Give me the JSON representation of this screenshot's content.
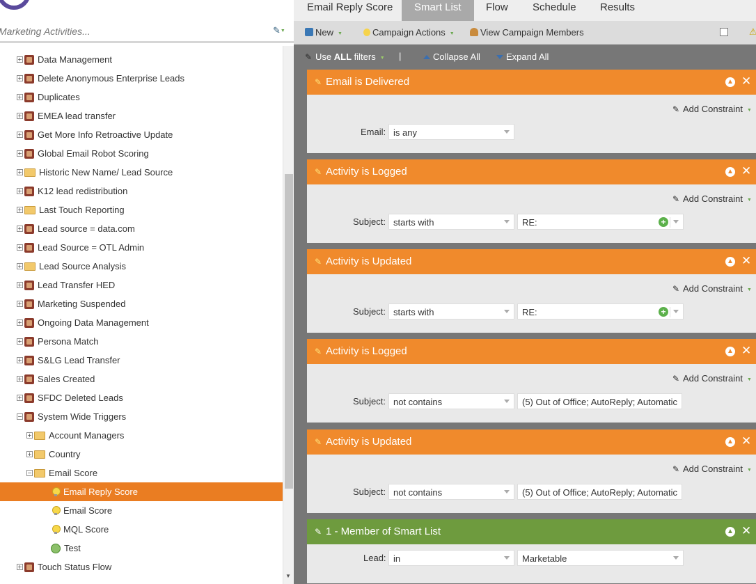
{
  "left_pane": {
    "search": {
      "placeholder": "Marketing Activities..."
    },
    "tree": [
      {
        "label": "Data Management",
        "icon": "campaign-folder-icon",
        "indent": 0,
        "expander": "+"
      },
      {
        "label": "Delete Anonymous Enterprise Leads",
        "icon": "campaign-folder-icon",
        "indent": 0,
        "expander": "+"
      },
      {
        "label": "Duplicates",
        "icon": "campaign-folder-icon",
        "indent": 0,
        "expander": "+"
      },
      {
        "label": "EMEA lead transfer",
        "icon": "campaign-folder-icon",
        "indent": 0,
        "expander": "+"
      },
      {
        "label": "Get More Info Retroactive Update",
        "icon": "campaign-folder-icon",
        "indent": 0,
        "expander": "+"
      },
      {
        "label": "Global Email Robot Scoring",
        "icon": "campaign-folder-icon",
        "indent": 0,
        "expander": "+"
      },
      {
        "label": "Historic New Name/ Lead Source",
        "icon": "folder-icon",
        "indent": 0,
        "expander": "+"
      },
      {
        "label": "K12 lead redistribution",
        "icon": "campaign-folder-icon",
        "indent": 0,
        "expander": "+"
      },
      {
        "label": "Last Touch Reporting",
        "icon": "folder-icon",
        "indent": 0,
        "expander": "+"
      },
      {
        "label": "Lead source = data.com",
        "icon": "campaign-folder-icon",
        "indent": 0,
        "expander": "+"
      },
      {
        "label": "Lead Source = OTL Admin",
        "icon": "campaign-folder-icon",
        "indent": 0,
        "expander": "+"
      },
      {
        "label": "Lead Source Analysis",
        "icon": "folder-icon",
        "indent": 0,
        "expander": "+"
      },
      {
        "label": "Lead Transfer HED",
        "icon": "campaign-folder-icon",
        "indent": 0,
        "expander": "+"
      },
      {
        "label": "Marketing Suspended",
        "icon": "campaign-folder-icon",
        "indent": 0,
        "expander": "+"
      },
      {
        "label": "Ongoing Data Management",
        "icon": "campaign-folder-icon",
        "indent": 0,
        "expander": "+"
      },
      {
        "label": "Persona Match",
        "icon": "campaign-folder-icon",
        "indent": 0,
        "expander": "+"
      },
      {
        "label": "S&LG Lead Transfer",
        "icon": "campaign-folder-icon",
        "indent": 0,
        "expander": "+"
      },
      {
        "label": "Sales Created",
        "icon": "campaign-folder-icon",
        "indent": 0,
        "expander": "+"
      },
      {
        "label": "SFDC Deleted Leads",
        "icon": "campaign-folder-icon",
        "indent": 0,
        "expander": "+"
      },
      {
        "label": "System Wide Triggers",
        "icon": "campaign-folder-icon",
        "indent": 0,
        "expander": "−"
      },
      {
        "label": "Account Managers",
        "icon": "folder-icon",
        "indent": 1,
        "expander": "+"
      },
      {
        "label": "Country",
        "icon": "folder-icon",
        "indent": 1,
        "expander": "+"
      },
      {
        "label": "Email Score",
        "icon": "folder-icon",
        "indent": 1,
        "expander": "−"
      },
      {
        "label": "Email Reply Score",
        "icon": "smart-campaign-icon",
        "indent": 2,
        "expander": "",
        "selected": true
      },
      {
        "label": "Email Score",
        "icon": "smart-campaign-icon",
        "indent": 2,
        "expander": ""
      },
      {
        "label": "MQL Score",
        "icon": "smart-campaign-icon",
        "indent": 2,
        "expander": ""
      },
      {
        "label": "Test",
        "icon": "test-campaign-icon",
        "indent": 2,
        "expander": ""
      },
      {
        "label": "Touch Status Flow",
        "icon": "campaign-folder-icon",
        "indent": 0,
        "expander": "+"
      }
    ]
  },
  "tabs": [
    {
      "label": "Email Reply Score",
      "active": false
    },
    {
      "label": "Smart List",
      "active": true
    },
    {
      "label": "Flow",
      "active": false
    },
    {
      "label": "Schedule",
      "active": false
    },
    {
      "label": "Results",
      "active": false
    }
  ],
  "toolbar": {
    "new_label": "New",
    "campaign_actions_label": "Campaign Actions",
    "view_members_label": "View Campaign Members"
  },
  "filterbar": {
    "use_prefix": "Use",
    "use_bold": "ALL",
    "use_suffix": "filters",
    "separator": "|",
    "collapse_label": "Collapse All",
    "expand_label": "Expand All"
  },
  "filters": [
    {
      "title": "Email is Delivered",
      "color": "#f08a2c",
      "add_constraint": "Add Constraint",
      "field_label": "Email:",
      "operator": "is any"
    },
    {
      "title": "Activity is Logged",
      "color": "#f08a2c",
      "add_constraint": "Add Constraint",
      "field_label": "Subject:",
      "operator": "starts with",
      "value": "RE:"
    },
    {
      "title": "Activity is Updated",
      "color": "#f08a2c",
      "add_constraint": "Add Constraint",
      "field_label": "Subject:",
      "operator": "starts with",
      "value": "RE:"
    },
    {
      "title": "Activity is Logged",
      "color": "#f08a2c",
      "add_constraint": "Add Constraint",
      "field_label": "Subject:",
      "operator": "not contains",
      "value": "(5) Out of Office; AutoReply; Automatic"
    },
    {
      "title": "Activity is Updated",
      "color": "#f08a2c",
      "add_constraint": "Add Constraint",
      "field_label": "Subject:",
      "operator": "not contains",
      "value": "(5) Out of Office; AutoReply; Automatic"
    },
    {
      "title": "1 - Member of Smart List",
      "color": "#6e9b3e",
      "field_label": "Lead:",
      "operator": "in",
      "value": "Marketable"
    }
  ]
}
